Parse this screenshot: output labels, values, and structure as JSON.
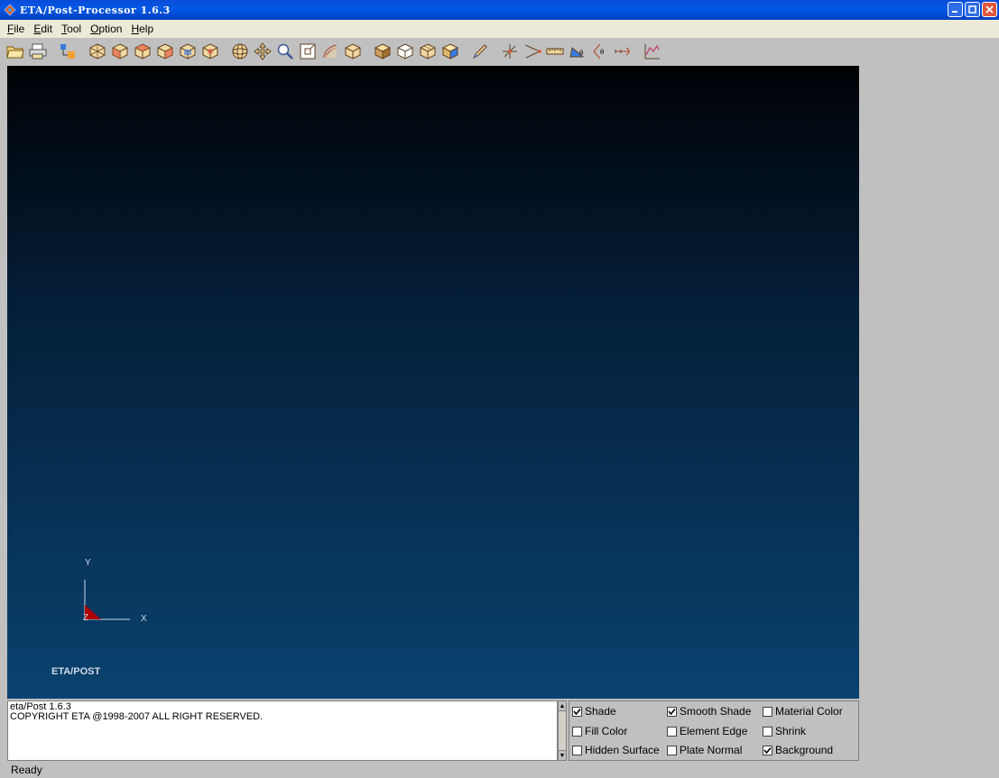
{
  "window": {
    "title": "ETA/Post-Processor 1.6.3"
  },
  "menu": {
    "items": [
      {
        "label": "File",
        "accel": "F",
        "rest": "ile"
      },
      {
        "label": "Edit",
        "accel": "E",
        "rest": "dit"
      },
      {
        "label": "Tool",
        "accel": "T",
        "rest": "ool"
      },
      {
        "label": "Option",
        "accel": "O",
        "rest": "ption"
      },
      {
        "label": "Help",
        "accel": "H",
        "rest": "elp"
      }
    ]
  },
  "toolbar": {
    "icons": [
      "open-folder-icon",
      "print-icon",
      "model-tree-icon",
      "view-iso-icon",
      "view-front-icon",
      "view-back-icon",
      "view-left-icon",
      "view-right-icon",
      "view-top-icon",
      "rotate-icon",
      "pan-icon",
      "zoom-icon",
      "zoom-window-icon",
      "fit-curve-icon",
      "wireframe-icon",
      "shade-cube-icon",
      "hidden-cube-icon",
      "box-cube-icon",
      "solid-cube-icon",
      "pen-icon",
      "node-icon",
      "angle-node-icon",
      "measure-distance-icon",
      "measure-angle-icon",
      "measure-arc-icon",
      "measure-length-icon",
      "graph-plot-icon"
    ]
  },
  "viewport": {
    "axis": {
      "x": "X",
      "y": "Y",
      "z": "Z"
    },
    "brand": "ETA/POST",
    "colors": {
      "top": "#000205",
      "bottom": "#09426f",
      "axis_triangle": "#b00000"
    }
  },
  "message": {
    "lines": [
      "eta/Post 1.6.3",
      "COPYRIGHT ETA @1998-2007 ALL RIGHT RESERVED."
    ]
  },
  "options": {
    "shade": {
      "label": "Shade",
      "checked": true
    },
    "smooth_shade": {
      "label": "Smooth Shade",
      "checked": true
    },
    "material_color": {
      "label": "Material Color",
      "checked": false
    },
    "fill_color": {
      "label": "Fill Color",
      "checked": false
    },
    "element_edge": {
      "label": "Element Edge",
      "checked": false
    },
    "shrink": {
      "label": "Shrink",
      "checked": false
    },
    "hidden_surface": {
      "label": "Hidden Surface",
      "checked": false
    },
    "plate_normal": {
      "label": "Plate Normal",
      "checked": false
    },
    "background": {
      "label": "Background",
      "checked": true
    }
  },
  "status": {
    "text": "Ready"
  }
}
